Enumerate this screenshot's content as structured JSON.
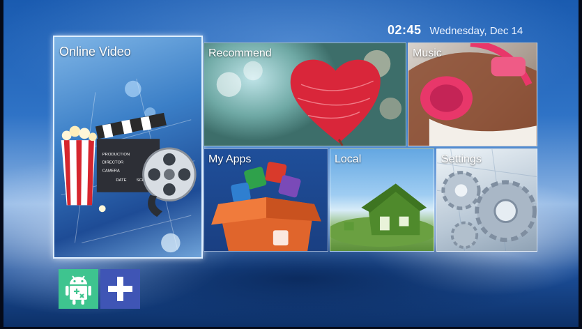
{
  "status": {
    "time": "02:45",
    "date": "Wednesday, Dec 14"
  },
  "tiles": {
    "online_video": "Online Video",
    "recommend": "Recommend",
    "music": "Music",
    "my_apps": "My Apps",
    "local": "Local",
    "settings": "Settings"
  },
  "clapper_text": {
    "production": "PRODUCTION",
    "director": "DIRECTOR",
    "camera": "CAMERA",
    "date": "DATE",
    "scene": "SCENE"
  },
  "dock": {
    "android_app": "android-app-icon",
    "add": "add-icon"
  },
  "colors": {
    "android_button": "#3ec48f",
    "add_button": "#3f55b5",
    "heart": "#d9263a"
  }
}
